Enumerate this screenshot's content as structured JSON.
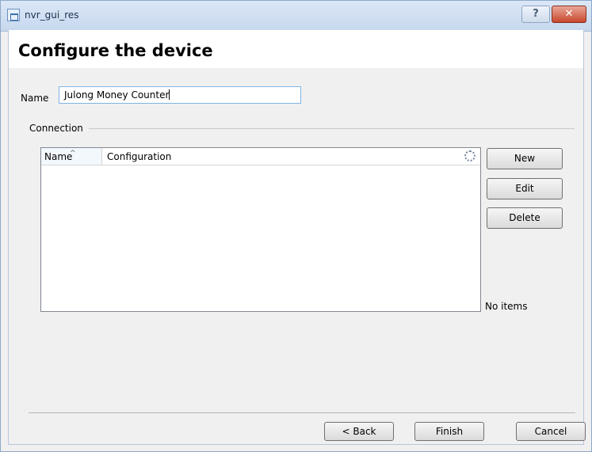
{
  "window": {
    "title": "nvr_gui_res",
    "help_label": "?",
    "close_label": "✕"
  },
  "header": {
    "title": "Configure the device"
  },
  "form": {
    "name_label": "Name",
    "name_value": "Julong Money Counter",
    "connection_label": "Connection"
  },
  "connection_table": {
    "columns": [
      "Name",
      "Configuration"
    ],
    "rows": [],
    "empty_text": "No items"
  },
  "side_buttons": {
    "new_label": "New",
    "edit_label": "Edit",
    "delete_label": "Delete"
  },
  "footer": {
    "back_label": "< Back",
    "finish_label": "Finish",
    "cancel_label": "Cancel"
  }
}
